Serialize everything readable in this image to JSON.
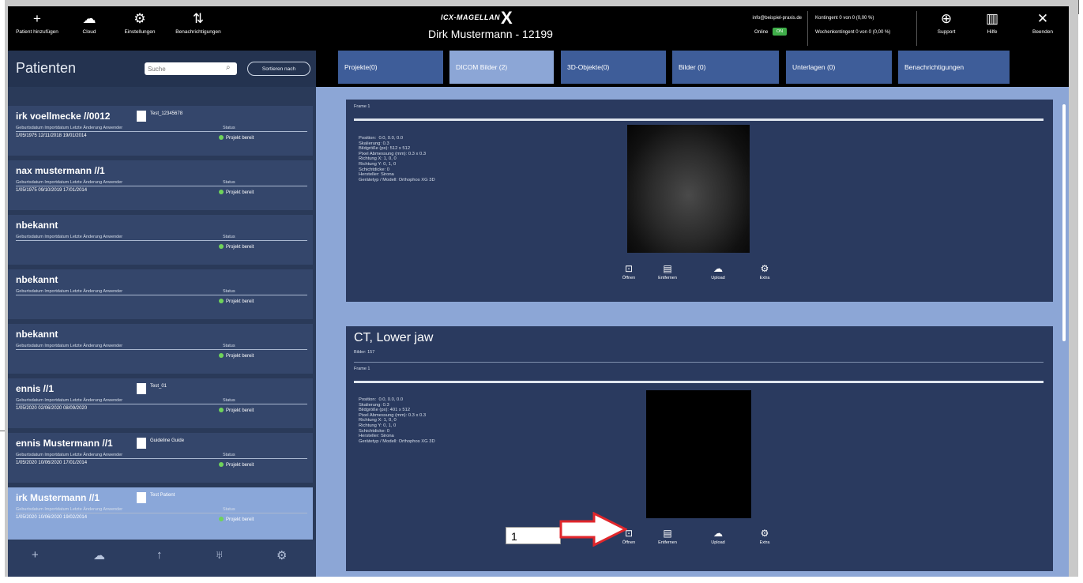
{
  "topbar": {
    "buttons": [
      {
        "label": "Patient hinzufügen",
        "icon": "plus-icon",
        "glyph": "+"
      },
      {
        "label": "Cloud",
        "icon": "cloud-icon",
        "glyph": "☁"
      },
      {
        "label": "Einstellungen",
        "icon": "gear-icon",
        "glyph": "⚙"
      },
      {
        "label": "Benachrichtigungen",
        "icon": "notification-icon",
        "glyph": "⇅"
      }
    ],
    "logo": "ICX-MAGELLAN",
    "logo_x": "X",
    "title": "Dirk Mustermann - 12199",
    "account_email": "info@beispiel-praxis.de",
    "online_label": "Online",
    "online_badge": "ON",
    "quota_1": "Kontingent 0 von 0 (0,00 %)",
    "quota_2": "Wochenkontingent 0 von 0 (0,00 %)",
    "right_buttons": [
      {
        "label": "Support",
        "icon": "globe-icon",
        "glyph": "⊕"
      },
      {
        "label": "Hilfe",
        "icon": "book-icon",
        "glyph": "▥"
      },
      {
        "label": "Beenden",
        "icon": "close-icon",
        "glyph": "✕"
      }
    ]
  },
  "patients": {
    "title": "Patienten",
    "search_placeholder": "Suche",
    "sort_label": "Sortieren nach",
    "col_headers": "Geburtsdatum   Importdatum   Letzte Änderung  Anwender",
    "status_label": "Status",
    "items": [
      {
        "name": "irk voellmecke //0012",
        "doc": "Test_12345678",
        "values": "1/05/1975   12/11/2018   19/01/2014",
        "status": "Projekt bereit"
      },
      {
        "name": "nax mustermann //1",
        "doc": "",
        "values": "1/05/1975   09/10/2019   17/01/2014",
        "status": "Projekt bereit"
      },
      {
        "name": "nbekannt",
        "doc": "",
        "values": "",
        "status": "Projekt bereit"
      },
      {
        "name": "nbekannt",
        "doc": "",
        "values": "",
        "status": "Projekt bereit"
      },
      {
        "name": "nbekannt",
        "doc": "",
        "values": "",
        "status": "Projekt bereit"
      },
      {
        "name": "ennis //1",
        "doc": "Test_01",
        "values": "1/05/2020   02/06/2020   08/09/2020",
        "status": "Projekt bereit"
      },
      {
        "name": "ennis Mustermann //1",
        "doc": "Guideline Guide",
        "values": "1/05/2020   10/06/2020   17/01/2014",
        "status": "Projekt bereit"
      },
      {
        "name": "irk Mustermann //1",
        "doc": "Test Patient",
        "values": "1/05/2020   10/06/2020   19/02/2014",
        "status": "Projekt bereit"
      }
    ]
  },
  "tabs": [
    {
      "label": "Projekte(0)"
    },
    {
      "label": "DICOM Bilder (2)"
    },
    {
      "label": "3D-Objekte(0)"
    },
    {
      "label": "Bilder (0)"
    },
    {
      "label": "Unterlagen (0)"
    },
    {
      "label": "Benachrichtigungen"
    }
  ],
  "dicom": [
    {
      "title": "",
      "sub1": "",
      "sub2": "Frame 1",
      "meta": "Position:  0.0, 0.0, 0.0\nSkalierung: 0.3\nBildgröße (px): 512 x 512\nPixel Abmessung (mm): 0.3 x 0.3\nRichtung X: 1, 0, 0\nRichtung Y: 0, 1, 0\nSchichtdicke: 0\nHersteller: Sirona\nGerätetyp / Modell: Orthophos XG 3D",
      "actions": [
        "Öffnen",
        "Entfernen",
        "Upload",
        "Extra"
      ]
    },
    {
      "title": "CT, Lower jaw",
      "sub1": "Bilder: 157",
      "sub2": "Frame 1",
      "meta": "Position:  0.0, 0.0, 0.0\nSkalierung: 0.3\nBildgröße (px): 401 x 512\nPixel Abmessung (mm): 0.3 x 0.3\nRichtung X: 1, 0, 0\nRichtung Y: 0, 1, 0\nSchichtdicke: 0\nHersteller: Sirona\nGerätetyp / Modell: Orthophos XG 3D",
      "actions": [
        "Öffnen",
        "Entfernen",
        "Upload",
        "Extra"
      ]
    }
  ],
  "callout": "1",
  "colors": {
    "accent": "#3e5d99",
    "panel": "#2a3a5f",
    "bg": "#8ca6d6",
    "status_green": "#6fd35a"
  }
}
